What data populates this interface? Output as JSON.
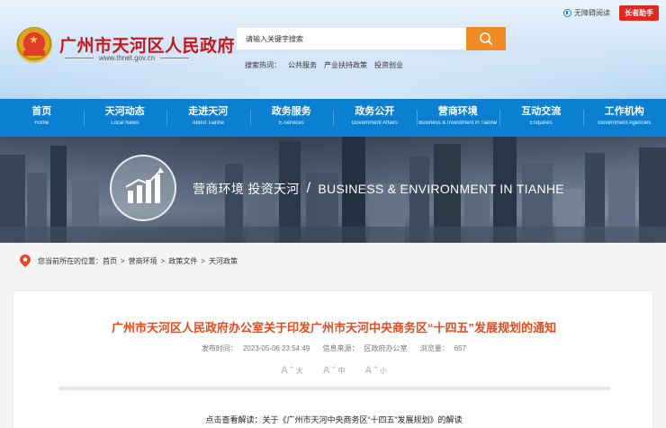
{
  "topbar": {
    "accessibility_label": "无障碍阅读",
    "elder_label": "长者助手"
  },
  "site": {
    "title": "广州市天河区人民政府",
    "url": "www.thnet.gov.cn"
  },
  "search": {
    "placeholder": "请输入关键字搜索",
    "hot_label": "搜索热词：",
    "hot_words": [
      "公共服务",
      "产业扶持政策",
      "投资创业"
    ]
  },
  "nav": [
    {
      "cn": "首页",
      "en": "Home"
    },
    {
      "cn": "天河动态",
      "en": "Local News"
    },
    {
      "cn": "走进天河",
      "en": "About Tianhe"
    },
    {
      "cn": "政务服务",
      "en": "E-services"
    },
    {
      "cn": "政务公开",
      "en": "Government Affairs"
    },
    {
      "cn": "营商环境",
      "en": "Business & Investment in Tianhe"
    },
    {
      "cn": "互动交流",
      "en": "Enquiries"
    },
    {
      "cn": "工作机构",
      "en": "Government Agencies"
    }
  ],
  "banner": {
    "cn": "营商环境 投资天河",
    "slash": "/",
    "en": "BUSINESS & ENVIRONMENT IN TIANHE"
  },
  "breadcrumb": {
    "label": "您当前所在的位置：",
    "items": [
      "首页",
      "营商环境",
      "政策文件",
      "天河政策"
    ],
    "sep": ">"
  },
  "article": {
    "title": "广州市天河区人民政府办公室关于印发广州市天河中央商务区“十四五”发展规划的通知",
    "publish_label": "发布时间：",
    "publish_time": "2023-05-06 23:54:49",
    "source_label": "信息来源：",
    "source": "区政府办公室",
    "views_label": "浏览量：",
    "views": "657",
    "font_sizes": [
      {
        "a": "A",
        "plus": "+",
        "label": "大"
      },
      {
        "a": "A",
        "plus": "+",
        "label": "中"
      },
      {
        "a": "A",
        "plus": "+",
        "label": "小"
      }
    ],
    "interpretation": "点击查看解读：关于《广州市天河中央商务区“十四五”发展规划》的解读"
  },
  "colors": {
    "nav_bg": "#0b7fd1",
    "title_red": "#c8161d",
    "article_title": "#e84a1b",
    "search_btn": "#f08a24",
    "elder_btn": "#e02720"
  }
}
